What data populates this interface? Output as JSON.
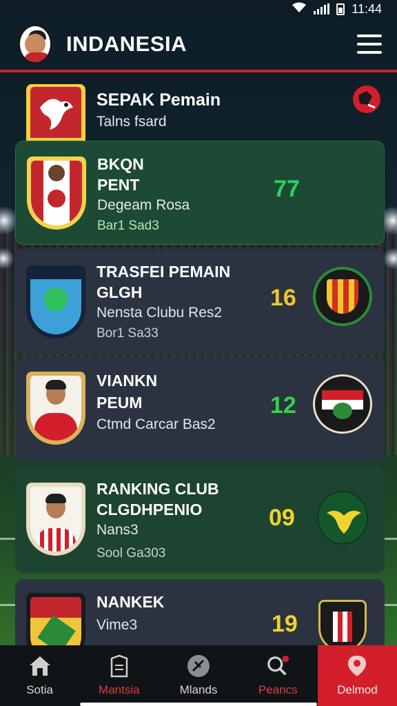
{
  "status_bar": {
    "time": "11:44"
  },
  "header": {
    "title": "INDANESIA"
  },
  "top_item": {
    "title": "SEPAK Pemain",
    "subtitle": "Talns fsard"
  },
  "cards": [
    {
      "line1": "BKQN",
      "line2": "PENT",
      "line3": "Degeam Rosa",
      "line4": "Bar1 Sad3",
      "score": "77",
      "score_color": "#2fd05a"
    },
    {
      "line1": "TRASFEI PEMAIN",
      "line2": "GLGH",
      "line3": "Nensta Clubu Res2",
      "line4": "Bor1 Sa33",
      "score": "16",
      "score_color": "#f0c52e"
    },
    {
      "line1": "VIANKN",
      "line2": "PEUM",
      "line3": "Ctmd Carcar  Bas2",
      "score": "12",
      "score_color": "#33d24a"
    },
    {
      "line1": "RANKING CLUB",
      "line2": "CLGDHPENIO",
      "line3": "Nans3",
      "line4": "Sool Ga303",
      "score": "09",
      "score_color": "#f0d32e"
    },
    {
      "line1": "NANKEK",
      "line2": "Vime3",
      "score": "19",
      "score_color": "#f0d32e"
    }
  ],
  "nav": {
    "items": [
      {
        "label": "Sotia",
        "icon": "home-icon"
      },
      {
        "label": "Mantsia",
        "icon": "document-icon"
      },
      {
        "label": "Mlands",
        "icon": "ball-icon"
      },
      {
        "label": "Peancs",
        "icon": "search-icon"
      },
      {
        "label": "Delmod",
        "icon": "location-icon"
      }
    ]
  },
  "colors": {
    "accent_red": "#d21f2b",
    "header_bg": "#0f1f2a",
    "card_green": "#1c4a35",
    "card_dark": "#2b3341"
  }
}
